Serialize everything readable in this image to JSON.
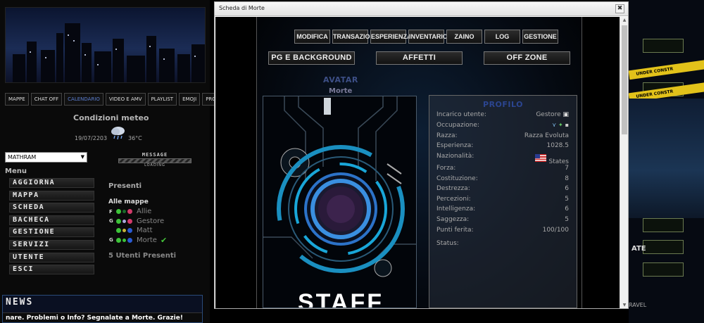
{
  "left": {
    "nav_buttons": [
      "MAPPE",
      "CHAT OFF",
      "CALENDARIO",
      "VIDEO E AMV",
      "PLAYLIST",
      "EMOJI",
      "PROSSIMAMENTE",
      ""
    ],
    "meteo": {
      "title": "Condizioni meteo",
      "date": "19/07/2203",
      "temp": "36°C",
      "icon": "rain-cloud-icon"
    },
    "location_select": "MATHRAM",
    "message": {
      "title": "MESSAGE",
      "subtitle": "LOADING"
    },
    "menu_title": "Menu",
    "menu_items": [
      "AGGIORNA",
      "MAPPA",
      "SCHEDA",
      "BACHECA",
      "GESTIONE",
      "SERVIZI",
      "UTENTE",
      "ESCI"
    ],
    "presenti": {
      "title": "Presenti",
      "group": "Alle mappe",
      "users": [
        {
          "flag": "F",
          "name": "Allie"
        },
        {
          "flag": "G",
          "name": "Gestore"
        },
        {
          "flag": "",
          "name": "Matt"
        },
        {
          "flag": "G",
          "name": "Morte"
        }
      ],
      "count": "5 Utenti Presenti"
    },
    "news": {
      "title": "NEWS",
      "ticker": "nare. Problemi o Info? Segnalate a Morte. Grazie!"
    }
  },
  "right": {
    "tape1": "UNDER CONSTR",
    "tape2": "UNDER CONSTR",
    "label": "ATE",
    "travel": "RAVEL"
  },
  "dialog": {
    "title": "Scheda di Morte",
    "close": "✖",
    "tabs_row1": [
      "MODIFICA",
      "TRANSAZIONI",
      "ESPERIENZA",
      "INVENTARIO",
      "ZAINO",
      "LOG",
      "GESTIONE"
    ],
    "tabs_row2": [
      "PG E BACKGROUND",
      "AFFETTI",
      "OFF ZONE"
    ],
    "avatar": {
      "title": "AVATAR",
      "name": "Morte",
      "caption": "STAFF"
    },
    "profile": {
      "title": "PROFILO",
      "rows": [
        {
          "key": "Incarico utente:",
          "value": "Gestore"
        },
        {
          "key": "Occupazione:",
          "value": ""
        },
        {
          "key": "Razza:",
          "value": "Razza Evoluta"
        },
        {
          "key": "Esperienza:",
          "value": "1028.5"
        },
        {
          "key": "Nazionalità:",
          "value": "States"
        },
        {
          "key": "Forza:",
          "value": "7"
        },
        {
          "key": "Costituzione:",
          "value": "8"
        },
        {
          "key": "Destrezza:",
          "value": "6"
        },
        {
          "key": "Percezioni:",
          "value": "5"
        },
        {
          "key": "Intelligenza:",
          "value": "6"
        },
        {
          "key": "Saggezza:",
          "value": "5"
        },
        {
          "key": "Punti ferita:",
          "value": "100/100"
        },
        {
          "key": "Status:",
          "value": ""
        }
      ]
    }
  },
  "colors": {
    "accent": "#2b4590",
    "portal": "#3a8fe0",
    "ring": "#1a9fd0",
    "online": "#3ec43a",
    "offline_btn": "#3a0c0c"
  }
}
